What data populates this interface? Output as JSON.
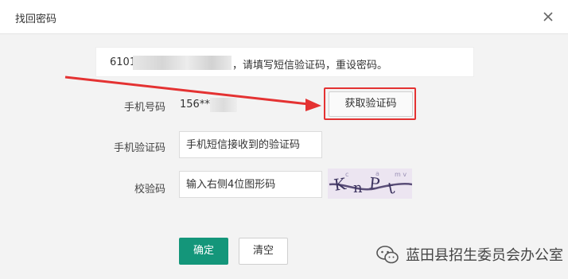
{
  "dialog": {
    "title": "找回密码",
    "close_icon": "close-icon"
  },
  "notice": {
    "prefix": "6101",
    "suffix": "，请填写短信验证码，重设密码。"
  },
  "form": {
    "phone_label": "手机号码",
    "phone_value": "156***",
    "get_code_label": "获取验证码",
    "sms_label": "手机验证码",
    "sms_placeholder": "手机短信接收到的验证码",
    "captcha_label": "校验码",
    "captcha_placeholder": "输入右侧4位图形码",
    "captcha_image_text": "KnPt"
  },
  "buttons": {
    "ok": "确定",
    "clear": "清空"
  },
  "watermark": {
    "text": "蓝田县招生委员会办公室"
  },
  "colors": {
    "primary": "#14967a",
    "highlight": "#e43232"
  }
}
